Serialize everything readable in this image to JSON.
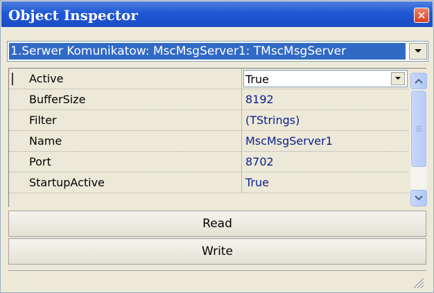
{
  "window": {
    "title": "Object Inspector",
    "close_glyph": "✕"
  },
  "object_selector": {
    "selected": "1.Serwer Komunikatow: MscMsgServer1: TMscMsgServer"
  },
  "properties": {
    "rows": [
      {
        "name": "Active",
        "value": "True"
      },
      {
        "name": "BufferSize",
        "value": "8192"
      },
      {
        "name": "Filter",
        "value": "(TStrings)"
      },
      {
        "name": "Name",
        "value": "MscMsgServer1"
      },
      {
        "name": "Port",
        "value": "8702"
      },
      {
        "name": "StartupActive",
        "value": "True"
      }
    ]
  },
  "buttons": {
    "read_label": "Read",
    "write_label": "Write"
  },
  "colors": {
    "titlebar": "#1f58d6",
    "selection": "#316ac5",
    "value_text": "#0c1d8c",
    "window_bg": "#ece9d8"
  },
  "icons": {
    "close": "close-icon",
    "dropdown": "chevron-down-icon",
    "scroll_up": "chevron-up-icon",
    "scroll_down": "chevron-down-icon",
    "resize": "resize-grip-icon"
  }
}
